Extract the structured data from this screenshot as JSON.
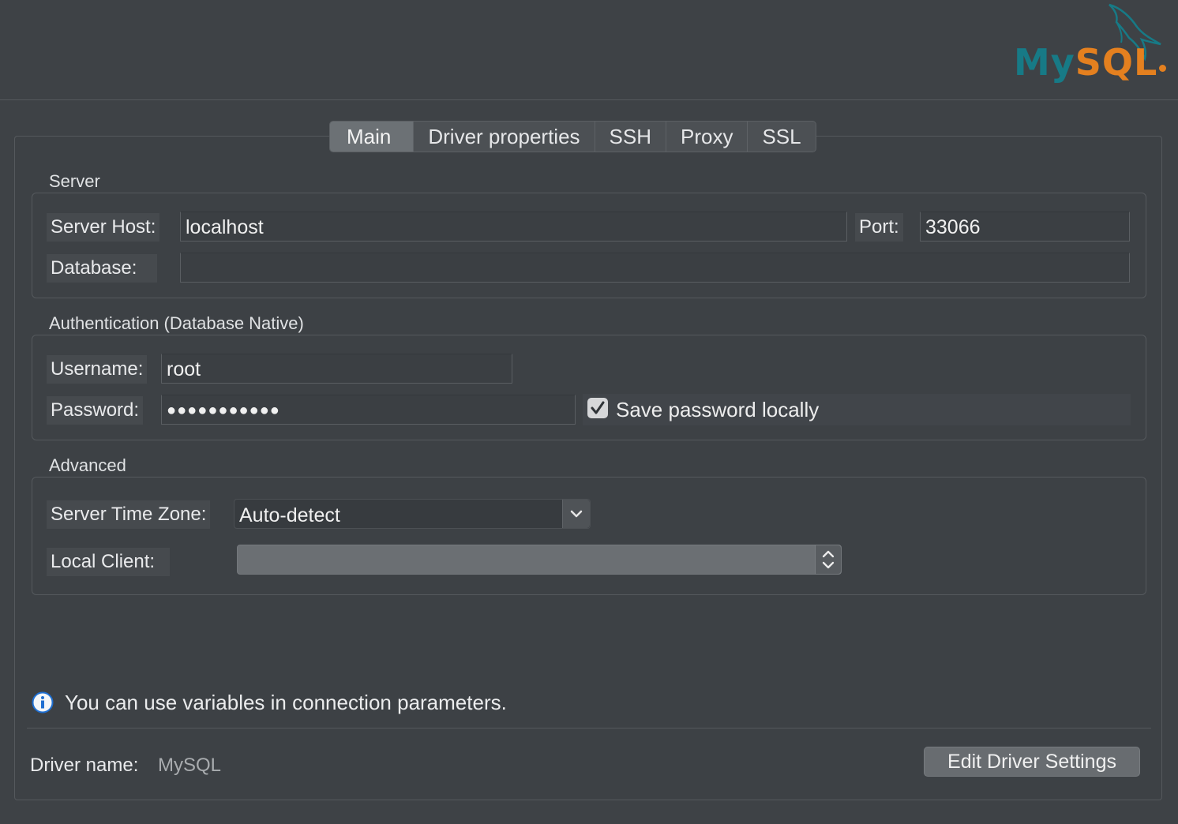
{
  "logo": {
    "part1": "My",
    "part2": "SQL"
  },
  "tabs": [
    {
      "label": "Main",
      "active": true
    },
    {
      "label": "Driver properties",
      "active": false
    },
    {
      "label": "SSH",
      "active": false
    },
    {
      "label": "Proxy",
      "active": false
    },
    {
      "label": "SSL",
      "active": false
    }
  ],
  "server": {
    "section_title": "Server",
    "host_label": "Server Host:",
    "host_value": "localhost",
    "port_label": "Port:",
    "port_value": "33066",
    "database_label": "Database:",
    "database_value": ""
  },
  "auth": {
    "section_title": "Authentication (Database Native)",
    "username_label": "Username:",
    "username_value": "root",
    "password_label": "Password:",
    "password_value": "●●●●●●●●●●●",
    "save_password_label": "Save password locally",
    "save_password_checked": true
  },
  "advanced": {
    "section_title": "Advanced",
    "timezone_label": "Server Time Zone:",
    "timezone_value": "Auto-detect",
    "local_client_label": "Local Client:",
    "local_client_value": ""
  },
  "footer": {
    "info_text": "You can use variables in connection parameters.",
    "driver_name_label": "Driver name:",
    "driver_name_value": "MySQL",
    "edit_driver_button": "Edit Driver Settings"
  },
  "colors": {
    "background": "#3e4246",
    "logo_teal": "#177a86",
    "logo_orange": "#e4801f",
    "info_blue": "#1f6fd1"
  }
}
